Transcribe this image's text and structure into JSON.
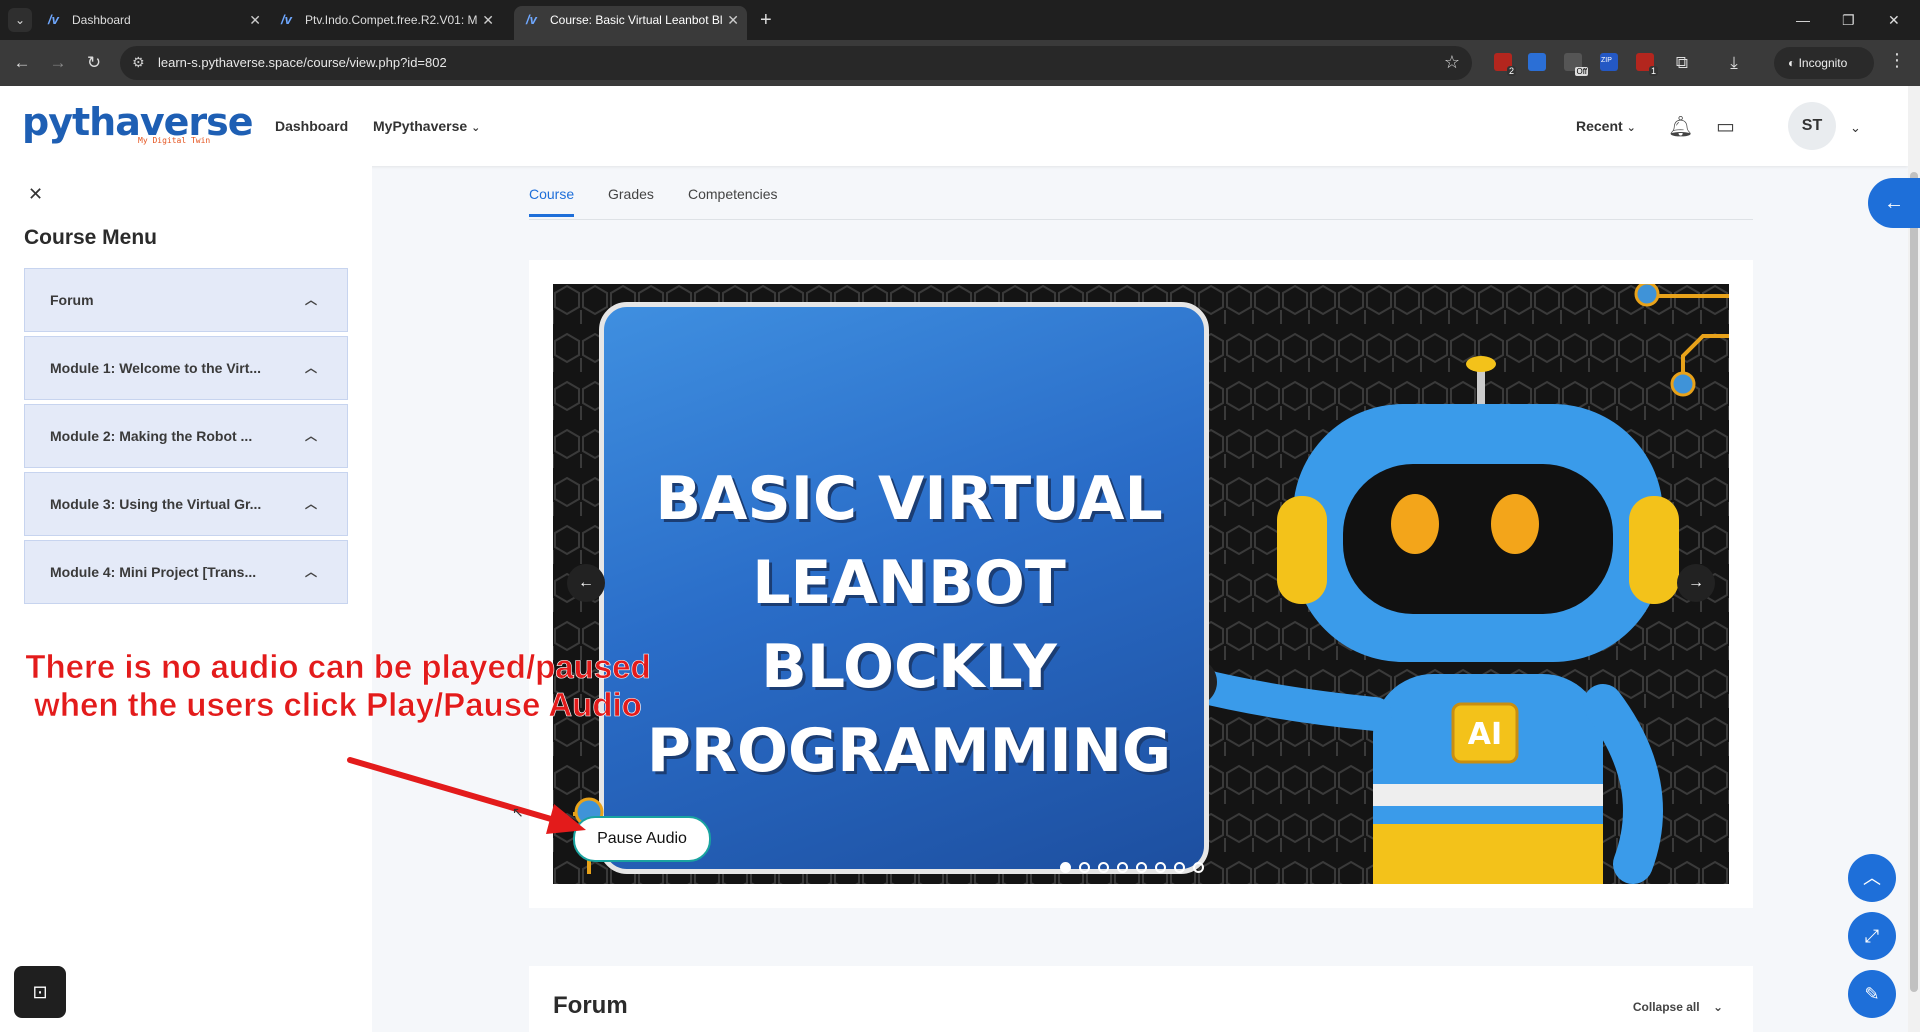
{
  "browser": {
    "tabs": [
      {
        "title": "Dashboard",
        "active": false
      },
      {
        "title": "Ptv.Indo.Compet.free.R2.V01: M",
        "active": false
      },
      {
        "title": "Course: Basic Virtual Leanbot Bl",
        "active": true
      }
    ],
    "url": "learn-s.pythaverse.space/course/view.php?id=802",
    "incognito_label": "Incognito",
    "ext_badges": [
      "2",
      "Off",
      "ZIP",
      "1"
    ]
  },
  "header": {
    "logo_text": "pythaverse",
    "logo_tagline": "My Digital Twin",
    "nav": [
      "Dashboard",
      "MyPythaverse"
    ],
    "recent_label": "Recent",
    "avatar_initials": "ST"
  },
  "sidebar": {
    "title": "Course Menu",
    "items": [
      {
        "label": "Forum"
      },
      {
        "label": "Module 1: Welcome to the Virt..."
      },
      {
        "label": "Module 2: Making the Robot ..."
      },
      {
        "label": "Module 3: Using the Virtual Gr..."
      },
      {
        "label": "Module 4: Mini Project [Trans..."
      }
    ]
  },
  "course_tabs": [
    {
      "label": "Course",
      "active": true
    },
    {
      "label": "Grades",
      "active": false
    },
    {
      "label": "Competencies",
      "active": false
    }
  ],
  "banner": {
    "title_lines": [
      "BASIC VIRTUAL",
      "LEANBOT BLOCKLY",
      "PROGRAMMING"
    ],
    "robot_chest_label": "AI",
    "slide_count": 8,
    "active_slide": 1,
    "pause_button_label": "Pause Audio"
  },
  "forum_section": {
    "title": "Forum",
    "collapse_label": "Collapse all"
  },
  "annotation": {
    "lines": [
      "There is no audio can be played/paused",
      "when the users click Play/Pause Audio"
    ],
    "color": "#e31b1b"
  },
  "accent_color": "#1e6fd9"
}
